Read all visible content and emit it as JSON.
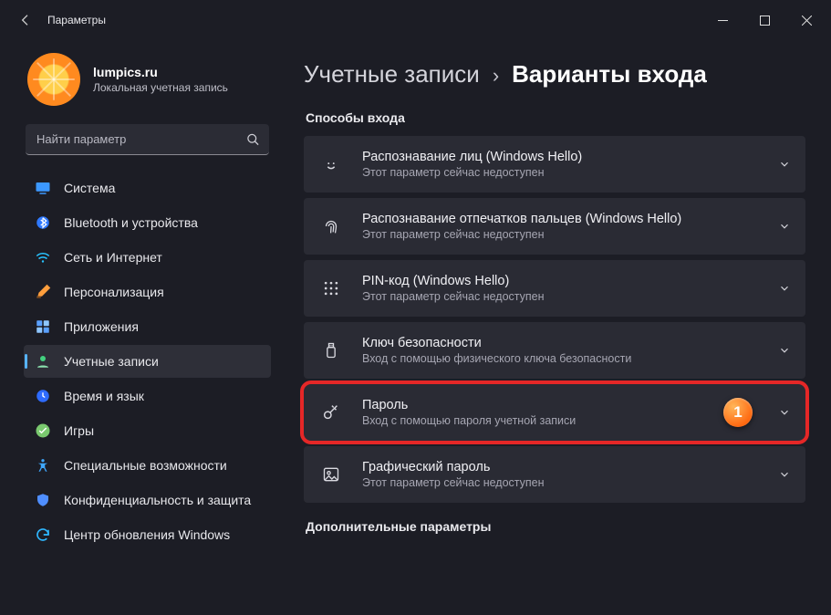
{
  "window": {
    "title": "Параметры"
  },
  "profile": {
    "name": "lumpics.ru",
    "sub": "Локальная учетная запись"
  },
  "search": {
    "placeholder": "Найти параметр"
  },
  "sidebar": {
    "items": [
      {
        "id": "system",
        "label": "Система"
      },
      {
        "id": "bluetooth",
        "label": "Bluetooth и устройства"
      },
      {
        "id": "network",
        "label": "Сеть и Интернет"
      },
      {
        "id": "personalization",
        "label": "Персонализация"
      },
      {
        "id": "apps",
        "label": "Приложения"
      },
      {
        "id": "accounts",
        "label": "Учетные записи"
      },
      {
        "id": "time",
        "label": "Время и язык"
      },
      {
        "id": "gaming",
        "label": "Игры"
      },
      {
        "id": "accessibility",
        "label": "Специальные возможности"
      },
      {
        "id": "privacy",
        "label": "Конфиденциальность и защита"
      },
      {
        "id": "update",
        "label": "Центр обновления Windows"
      }
    ]
  },
  "breadcrumb": {
    "parent": "Учетные записи",
    "sep": "›",
    "current": "Варианты входа"
  },
  "section1": "Способы входа",
  "section2": "Дополнительные параметры",
  "signin": {
    "face": {
      "title": "Распознавание лиц (Windows Hello)",
      "sub": "Этот параметр сейчас недоступен"
    },
    "finger": {
      "title": "Распознавание отпечатков пальцев (Windows Hello)",
      "sub": "Этот параметр сейчас недоступен"
    },
    "pin": {
      "title": "PIN-код (Windows Hello)",
      "sub": "Этот параметр сейчас недоступен"
    },
    "key": {
      "title": "Ключ безопасности",
      "sub": "Вход с помощью физического ключа безопасности"
    },
    "pass": {
      "title": "Пароль",
      "sub": "Вход с помощью пароля учетной записи"
    },
    "pic": {
      "title": "Графический пароль",
      "sub": "Этот параметр сейчас недоступен"
    }
  },
  "marker": {
    "label": "1"
  }
}
